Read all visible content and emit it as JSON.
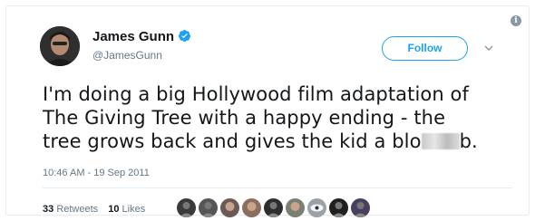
{
  "author": {
    "name": "James Gunn",
    "handle": "@JamesGunn",
    "verified": true
  },
  "follow_button": {
    "label": "Follow"
  },
  "tweet": {
    "lines": [
      "I'm doing a big Hollywood film adaptation of",
      "The Giving Tree with a happy ending - the",
      "tree grows back and gives the kid a blo"
    ],
    "line3_end": "b.",
    "timestamp": "10:46 AM - 19 Sep 2011"
  },
  "stats": {
    "retweets_count": "33",
    "retweets_label": "Retweets",
    "likes_count": "10",
    "likes_label": "Likes"
  },
  "likers": [
    {
      "icon": "avatar-dark-icon",
      "color": "#3a3a3a"
    },
    {
      "icon": "avatar-dark-icon",
      "color": "#555555"
    },
    {
      "icon": "avatar-face-icon",
      "color": "#6b5a55"
    },
    {
      "icon": "avatar-face-icon",
      "color": "#8b6f5e"
    },
    {
      "icon": "avatar-dark-icon",
      "color": "#2d2d2d"
    },
    {
      "icon": "avatar-face-icon",
      "color": "#7a7f72"
    },
    {
      "icon": "avatar-eye-icon",
      "color": "#9aa1a8"
    },
    {
      "icon": "avatar-dark-icon",
      "color": "#1f1f1f"
    },
    {
      "icon": "avatar-dark-icon",
      "color": "#4a3f5c"
    }
  ],
  "colors": {
    "accent": "#1da1f2",
    "secondary_text": "#657786",
    "border": "#e6ecf0"
  }
}
